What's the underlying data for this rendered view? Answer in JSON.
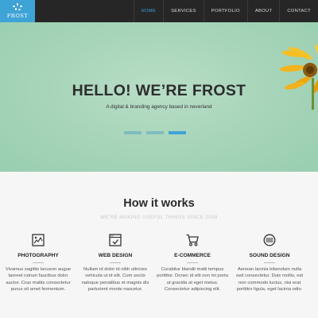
{
  "header": {
    "logo_text": "FROST",
    "nav": [
      "HOME",
      "SERVICES",
      "PORTFOLIO",
      "ABOUT",
      "CONTACT"
    ],
    "active_nav": "HOME"
  },
  "hero": {
    "title": "HELLO! WE’RE FROST",
    "subtitle": "A digital & branding agency based in neverland",
    "slider_dots": 3,
    "active_dot": 3
  },
  "how": {
    "title": "How it works",
    "subtitle": "WE’RE MAKING USEFUL THINGS SINCE 2008",
    "services": [
      {
        "icon": "picture-frame-icon",
        "name": "PHOTOGRAPHY",
        "desc": "Vivamus sagittis lacuson augue laoreet rutrum faucibus dolor auctor. Cras mattis consectetur purus sit amet fermentum."
      },
      {
        "icon": "browser-check-icon",
        "name": "WEB DESIGN",
        "desc": "Nullam id dolor id nibh ultricies vehicula ut id elit. Cum sociis natoque penatibus et magnis dis parturient monte nascetur."
      },
      {
        "icon": "shopping-cart-icon",
        "name": "E-COMMERCE",
        "desc": "Curabitur blandit matti tempus porttitor. Donec id elit non mi porta ut gravida at eget metus. Consectetur adipiscing elit."
      },
      {
        "icon": "radio-icon",
        "name": "SOUND DESIGN",
        "desc": "Aenean lacinia bibendum nulla sed consectetur. Duis mollis, est non commodo luctus, nisi erat porttitor ligula, eget lacinia odio."
      }
    ]
  },
  "colors": {
    "accent": "#3ea3d6",
    "topbar": "#262626",
    "hero_bg": "#a7d5ba"
  }
}
